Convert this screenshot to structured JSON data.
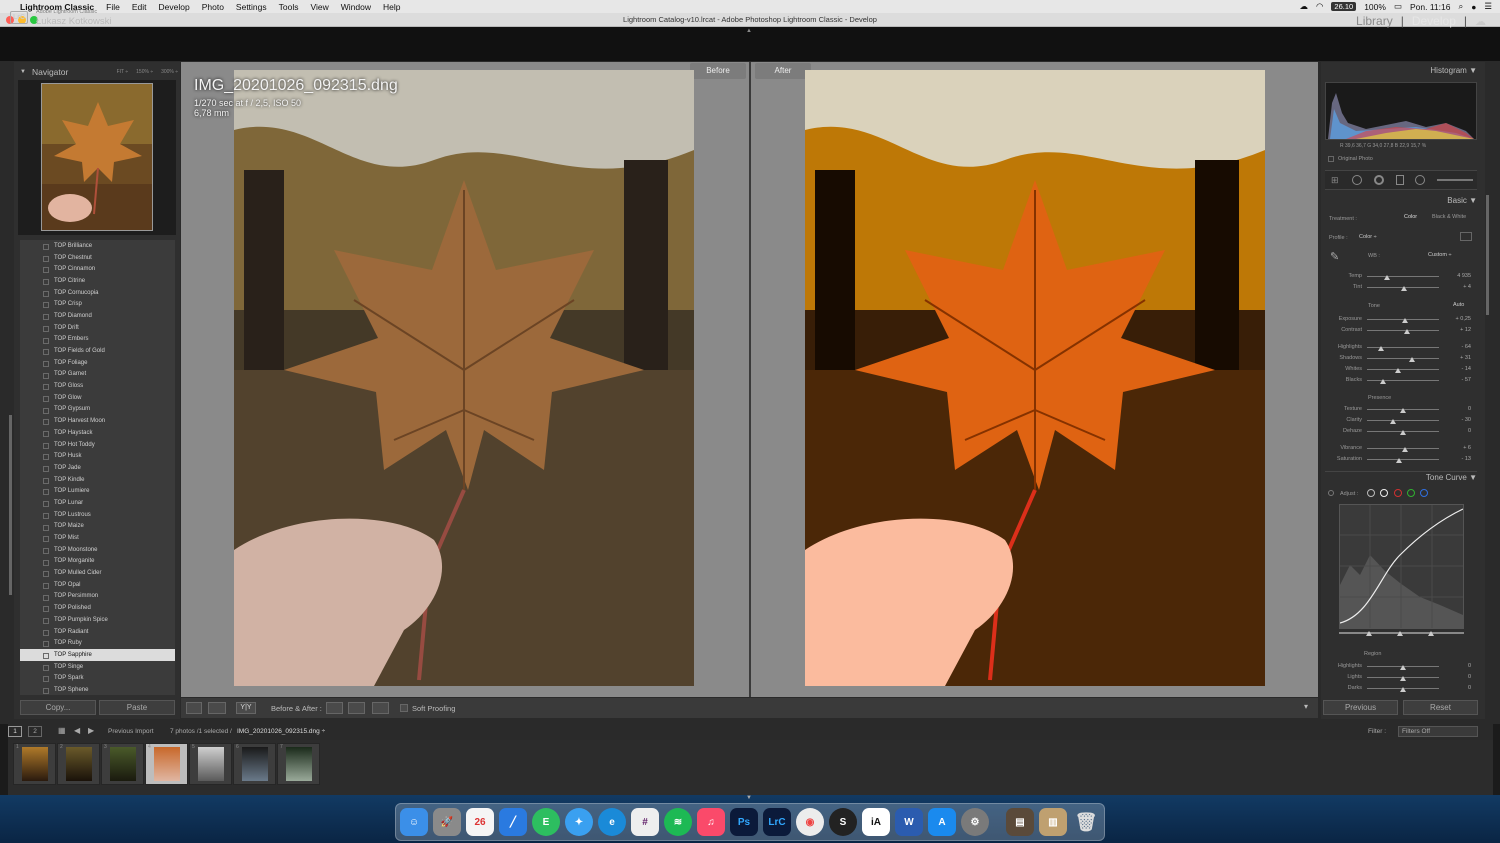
{
  "menubar": {
    "app": "Lightroom Classic",
    "items": [
      "File",
      "Edit",
      "Develop",
      "Photo",
      "Settings",
      "Tools",
      "View",
      "Window",
      "Help"
    ],
    "date": "26.10",
    "battery": "100%",
    "clock": "Pon. 11:16"
  },
  "window": {
    "title": "Lightroom Catalog-v10.lrcat - Adobe Photoshop Lightroom Classic - Develop"
  },
  "identity": {
    "badge": "LrC",
    "product": "Adobe Lightroom Classic",
    "user": "Łukasz Kotkowski"
  },
  "modules": {
    "library": "Library",
    "develop": "Develop",
    "separator": "|"
  },
  "navigator": {
    "title": "Navigator",
    "fit": "FIT ÷",
    "z1": "150% ÷",
    "z2": "300% ÷"
  },
  "presets": [
    "TOP Brilliance",
    "TOP Chestnut",
    "TOP Cinnamon",
    "TOP Citrine",
    "TOP Cornucopia",
    "TOP Crisp",
    "TOP Diamond",
    "TOP Drift",
    "TOP Embers",
    "TOP Fields of Gold",
    "TOP Foliage",
    "TOP Garnet",
    "TOP Gloss",
    "TOP Glow",
    "TOP Gypsum",
    "TOP Harvest Moon",
    "TOP Haystack",
    "TOP Hot Toddy",
    "TOP Husk",
    "TOP Jade",
    "TOP Kindle",
    "TOP Lumiere",
    "TOP Lunar",
    "TOP Lustrous",
    "TOP Maize",
    "TOP Mist",
    "TOP Moonstone",
    "TOP Morganite",
    "TOP Mulled Cider",
    "TOP Opal",
    "TOP Persimmon",
    "TOP Polished",
    "TOP Pumpkin Spice",
    "TOP Radiant",
    "TOP Ruby",
    "TOP Sapphire",
    "TOP Singe",
    "TOP Spark",
    "TOP Sphene"
  ],
  "selected_preset_index": 35,
  "left_buttons": {
    "copy": "Copy...",
    "paste": "Paste"
  },
  "view": {
    "before": "Before",
    "after": "After",
    "filename": "IMG_20201026_092315.dng",
    "exif": "1/270 sec at f / 2,5, ISO 50",
    "focal": "6,78 mm"
  },
  "toolbar": {
    "before_after": "Before & After :",
    "soft_proofing": "Soft Proofing",
    "yy": "Y|Y"
  },
  "histogram": {
    "title": "Histogram",
    "readout": "R  39,6  36,7  G  34,0  27,8  B  22,9  15,7  %",
    "original": "Original Photo"
  },
  "basic": {
    "title": "Basic",
    "treatment_label": "Treatment :",
    "color": "Color",
    "bw": "Black & White",
    "profile_label": "Profile :",
    "profile_value": "Color ÷",
    "wb_label": "WB :",
    "wb_value": "Custom ÷",
    "tone": "Tone",
    "auto": "Auto",
    "presence": "Presence",
    "sliders": [
      {
        "name": "Temp",
        "value": "4 935",
        "pos": 0.28
      },
      {
        "name": "Tint",
        "value": "+ 4",
        "pos": 0.52
      },
      {
        "name": "Exposure",
        "value": "+ 0,25",
        "pos": 0.53
      },
      {
        "name": "Contrast",
        "value": "+ 12",
        "pos": 0.55
      },
      {
        "name": "Highlights",
        "value": "- 64",
        "pos": 0.2
      },
      {
        "name": "Shadows",
        "value": "+ 31",
        "pos": 0.62
      },
      {
        "name": "Whites",
        "value": "- 14",
        "pos": 0.43
      },
      {
        "name": "Blacks",
        "value": "- 57",
        "pos": 0.22
      },
      {
        "name": "Texture",
        "value": "0",
        "pos": 0.5
      },
      {
        "name": "Clarity",
        "value": "- 30",
        "pos": 0.36
      },
      {
        "name": "Dehaze",
        "value": "0",
        "pos": 0.5
      },
      {
        "name": "Vibrance",
        "value": "+ 6",
        "pos": 0.53
      },
      {
        "name": "Saturation",
        "value": "- 13",
        "pos": 0.44
      }
    ]
  },
  "tone_curve": {
    "title": "Tone Curve",
    "adjust": "Adjust :",
    "region": "Region",
    "sliders": [
      {
        "name": "Highlights",
        "value": "0",
        "pos": 0.5
      },
      {
        "name": "Lights",
        "value": "0",
        "pos": 0.5
      },
      {
        "name": "Darks",
        "value": "0",
        "pos": 0.5
      }
    ]
  },
  "right_buttons": {
    "previous": "Previous",
    "reset": "Reset"
  },
  "filmstrip": {
    "page1": "1",
    "page2": "2",
    "source": "Previous Import",
    "count": "7 photos /1 selected /",
    "current": "IMG_20201026_092315.dng ÷",
    "filter_label": "Filter :",
    "filter_value": "Filters Off",
    "selected_index": 3,
    "thumb_numbers": [
      "1",
      "2",
      "3",
      "4",
      "5",
      "6",
      "7"
    ]
  },
  "colors": {
    "accent": "#dcdcdc",
    "panel": "#2f2f2f",
    "center": "#8a8a8a"
  }
}
